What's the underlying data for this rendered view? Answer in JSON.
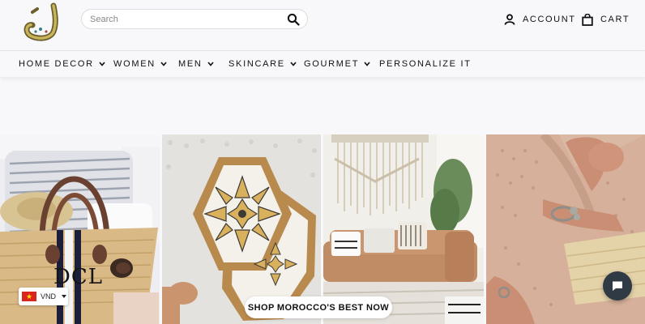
{
  "brand": {
    "logo_icon": "arabic-calligraphy-logo-icon"
  },
  "search": {
    "placeholder": "Search",
    "icon": "search-icon"
  },
  "account": {
    "label": "ACCOUNT",
    "icon": "user-icon"
  },
  "cart": {
    "label": "CART",
    "icon": "shopping-bag-icon"
  },
  "nav": {
    "items": [
      {
        "label": "HOME DECOR",
        "has_dropdown": true
      },
      {
        "label": "WOMEN",
        "has_dropdown": true
      },
      {
        "label": "MEN",
        "has_dropdown": true
      },
      {
        "label": "SKINCARE",
        "has_dropdown": true
      },
      {
        "label": "GOURMET",
        "has_dropdown": true
      },
      {
        "label": "PERSONALIZE IT",
        "has_dropdown": false
      }
    ]
  },
  "gallery": {
    "panels": [
      {
        "subject": "woven straw basket bag",
        "monogram": "DCL"
      },
      {
        "subject": "hexagonal moroccan geometric trays"
      },
      {
        "subject": "living room with macrame wall hanging and leather sofa"
      },
      {
        "subject": "woman wearing bracelets holding woven clutch"
      }
    ],
    "cta_label": "SHOP MOROCCO'S BEST NOW"
  },
  "currency": {
    "code": "VND",
    "flag_icon": "vietnam-flag-icon"
  },
  "chat": {
    "icon": "chat-bubble-icon"
  },
  "colors": {
    "background": "#f8f8fb",
    "text": "#111111",
    "chat_button": "#2f3a45"
  }
}
